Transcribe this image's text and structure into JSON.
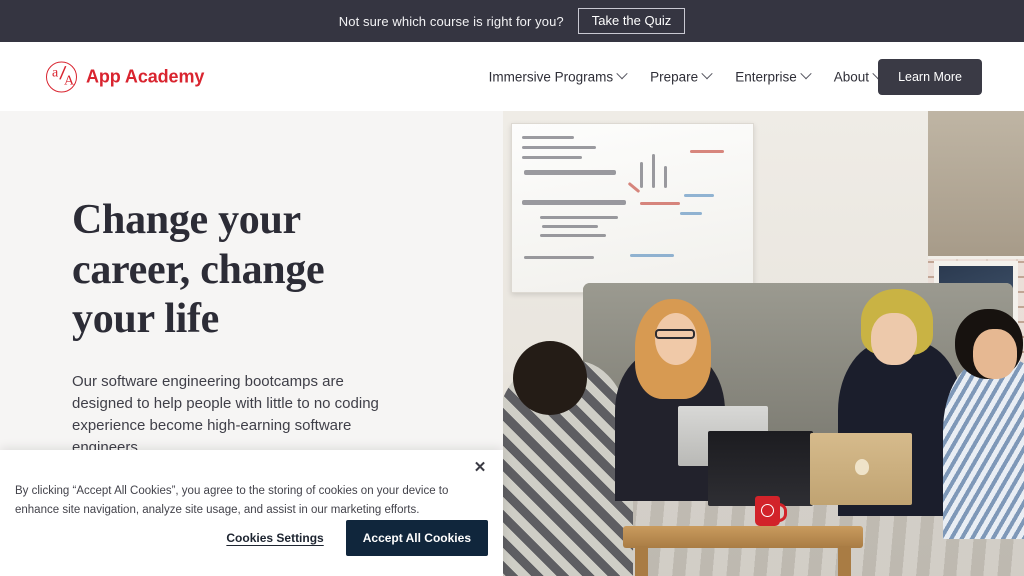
{
  "announcement": {
    "text": "Not sure which course is right for you?",
    "cta_label": "Take the Quiz"
  },
  "header": {
    "brand_name": "App Academy",
    "logo_letter_a": "a",
    "logo_slash": "/",
    "logo_letter_A": "A",
    "nav_items": [
      {
        "label": "Immersive Programs",
        "has_dropdown": true
      },
      {
        "label": "Prepare",
        "has_dropdown": true
      },
      {
        "label": "Enterprise",
        "has_dropdown": true
      },
      {
        "label": "About",
        "has_dropdown": true
      }
    ],
    "cta_label": "Learn More"
  },
  "hero": {
    "title_line_1": "Change your",
    "title_line_2": "career, change",
    "title_line_3": "your life",
    "subtitle": "Our software engineering bootcamps are designed to help people with little to no coding experience become high-earning software engineers.",
    "image_alt": "Four students with laptops sitting around a wooden coffee table in front of a whiteboard covered in math equations"
  },
  "cookie_banner": {
    "close_label": "✕",
    "body": "By clicking “Accept All Cookies”, you agree to the storing of cookies on your device to enhance site navigation, analyze site usage, and assist in our marketing efforts.",
    "settings_label": "Cookies Settings",
    "accept_label": "Accept All Cookies"
  },
  "colors": {
    "announcement_bg": "#353541",
    "brand_red": "#d9242f",
    "header_bg": "#ffffff",
    "hero_bg": "#f6f5f4",
    "heading_text": "#2c2c36",
    "learn_more_btn": "#3a3a45",
    "accept_btn": "#10263c"
  }
}
